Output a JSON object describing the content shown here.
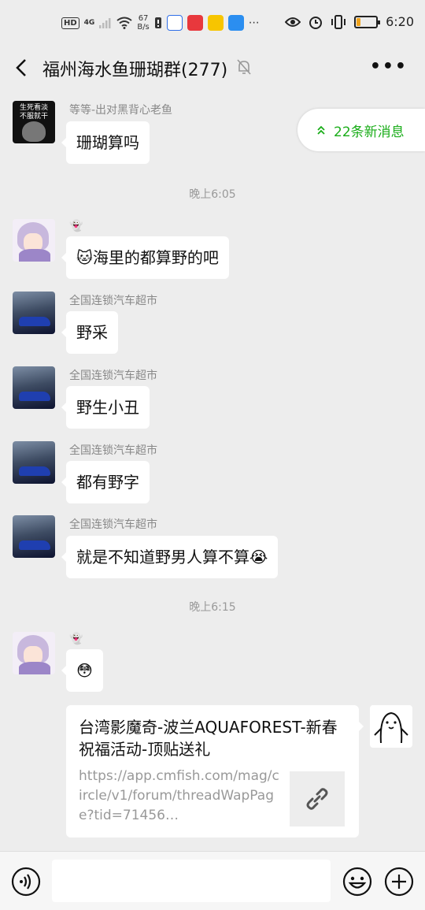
{
  "status_bar": {
    "network": "4G",
    "speed": "67\nB/s",
    "time": "6:20",
    "battery_percent": 20,
    "hd_label": "HD"
  },
  "chat": {
    "title": "福州海水鱼珊瑚群(277)",
    "new_messages_label": "22条新消息"
  },
  "messages": [
    {
      "type": "text",
      "sender": "等等-出对黑背心老鱼",
      "text": "珊瑚算吗",
      "avatar_text": "生死看淡\n不服就干"
    },
    {
      "type": "time",
      "text": "晚上6:05"
    },
    {
      "type": "text",
      "sender": "👻",
      "text": "🐱海里的都算野的吧"
    },
    {
      "type": "text",
      "sender": "全国连锁汽车超市",
      "text": "野采"
    },
    {
      "type": "text",
      "sender": "全国连锁汽车超市",
      "text": "野生小丑"
    },
    {
      "type": "text",
      "sender": "全国连锁汽车超市",
      "text": "都有野字"
    },
    {
      "type": "text",
      "sender": "全国连锁汽车超市",
      "text": "就是不知道野男人算不算😭"
    },
    {
      "type": "time",
      "text": "晚上6:15"
    },
    {
      "type": "text",
      "sender": "👻",
      "text": "😳"
    }
  ],
  "link_card": {
    "title": "台湾影魔奇-波兰AQUAFOREST-新春祝福活动-顶贴送礼",
    "url": "https://app.cmfish.com/mag/circle/v1/forum/threadWapPage?tid=71456…"
  },
  "icons": {
    "back": "chevron-left-icon",
    "mute": "bell-off-icon",
    "more": "more-dots-icon",
    "voice": "voice-icon",
    "emoji": "emoji-icon",
    "plus": "plus-icon",
    "link": "link-icon"
  }
}
